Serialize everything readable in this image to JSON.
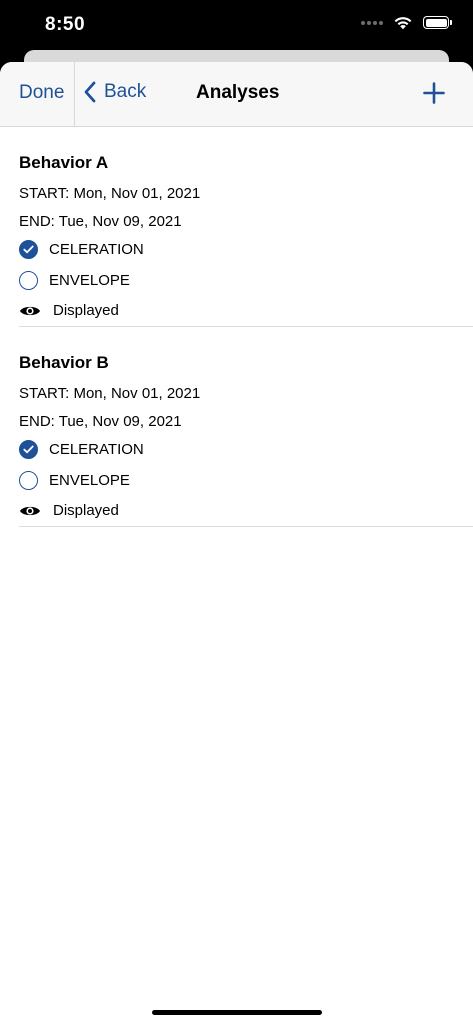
{
  "status_bar": {
    "time": "8:50"
  },
  "nav": {
    "done_label": "Done",
    "back_label": "Back",
    "title": "Analyses"
  },
  "analyses": [
    {
      "name": "Behavior A",
      "start": "START: Mon, Nov 01, 2021",
      "end": "END: Tue, Nov 09, 2021",
      "options": [
        {
          "label": "CELERATION",
          "checked": true
        },
        {
          "label": "ENVELOPE",
          "checked": false
        }
      ],
      "displayed_label": "Displayed"
    },
    {
      "name": "Behavior B",
      "start": "START: Mon, Nov 01, 2021",
      "end": "END: Tue, Nov 09, 2021",
      "options": [
        {
          "label": "CELERATION",
          "checked": true
        },
        {
          "label": "ENVELOPE",
          "checked": false
        }
      ],
      "displayed_label": "Displayed"
    }
  ],
  "colors": {
    "accent": "#1f5198",
    "nav_background": "#f7f7f7",
    "separator": "#dcdcdc"
  },
  "icons": {
    "back": "chevron-left-icon",
    "add": "plus-icon",
    "checked": "checkmark-circle-icon",
    "unchecked": "empty-circle-icon",
    "visibility": "eye-icon",
    "wifi": "wifi-icon",
    "battery": "battery-icon"
  }
}
